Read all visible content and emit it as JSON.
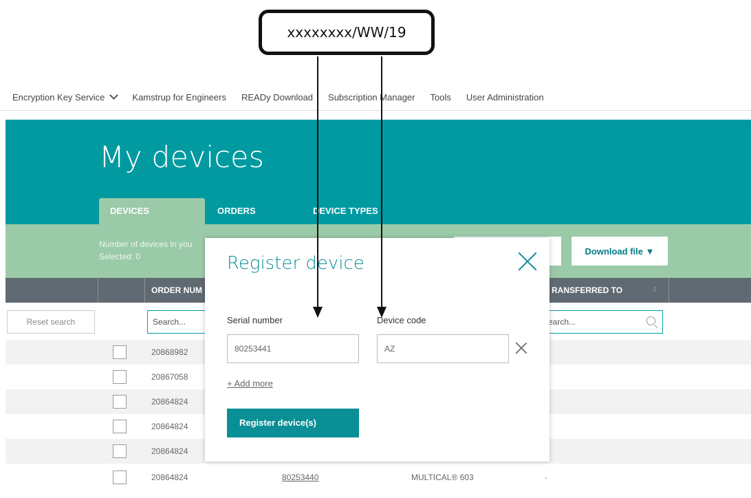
{
  "callout": {
    "text": "xxxxxxxx/WW/19"
  },
  "nav": {
    "items": [
      {
        "label": "Encryption Key Service"
      },
      {
        "label": "Kamstrup for Engineers"
      },
      {
        "label": "READy Download"
      },
      {
        "label": "Subscription Manager"
      },
      {
        "label": "Tools"
      },
      {
        "label": "User Administration"
      }
    ]
  },
  "hero": {
    "title": "My devices"
  },
  "tabs": [
    {
      "label": "DEVICES"
    },
    {
      "label": "ORDERS"
    },
    {
      "label": "DEVICE TYPES"
    }
  ],
  "band": {
    "count_text": "Number of devices in you",
    "selected_text": "Selected: 0",
    "download_label": "Download file ▼"
  },
  "table": {
    "headers": {
      "order_number": "ORDER NUM",
      "transferred_to": "RANSFERRED TO"
    },
    "reset_label": "Reset search",
    "search_placeholder": "Search...",
    "search_placeholder_right": "earch...",
    "rows": [
      {
        "order": "20868982",
        "serial": "",
        "type": "",
        "transfer": ""
      },
      {
        "order": "20867058",
        "serial": "",
        "type": "",
        "transfer": ""
      },
      {
        "order": "20864824",
        "serial": "",
        "type": "",
        "transfer": ""
      },
      {
        "order": "20864824",
        "serial": "",
        "type": "",
        "transfer": ""
      },
      {
        "order": "20864824",
        "serial": "",
        "type": "",
        "transfer": ""
      },
      {
        "order": "20864824",
        "serial": "80253440",
        "type": "MULTICAL® 603",
        "transfer": "-"
      }
    ]
  },
  "modal": {
    "title": "Register device",
    "serial_label": "Serial number",
    "serial_value": "80253441",
    "code_label": "Device code",
    "code_value": "AZ",
    "add_more": "+ Add more",
    "register_label": "Register device(s)"
  },
  "colors": {
    "teal": "#009aa0",
    "green_band": "#9bcaa9",
    "header_gray": "#606a72",
    "modal_accent": "#0a8f96"
  }
}
